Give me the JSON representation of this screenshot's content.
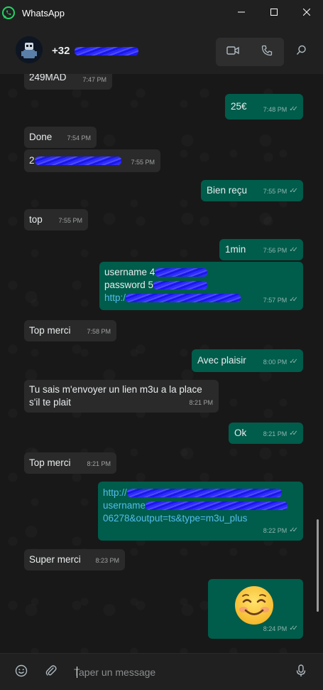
{
  "window": {
    "title": "WhatsApp"
  },
  "header": {
    "contact_prefix": "+32"
  },
  "colors": {
    "incoming": "#2a2a2a",
    "outgoing": "#005c4b",
    "link": "#53bdeb",
    "accent": "#00a884"
  },
  "messages": [
    {
      "text": "249MAD",
      "time": "7:47 PM"
    },
    {
      "text": "25€",
      "time": "7:48 PM"
    },
    {
      "text": "Done",
      "time": "7:54 PM"
    },
    {
      "text": "2",
      "time": "7:55 PM"
    },
    {
      "text": "Bien reçu",
      "time": "7:55 PM"
    },
    {
      "text": "top",
      "time": "7:55 PM"
    },
    {
      "text": "1min",
      "time": "7:56 PM"
    },
    {
      "line1": "username 4",
      "line2": "password 5",
      "line3": "http:/",
      "time": "7:57 PM"
    },
    {
      "text": "Top merci",
      "time": "7:58 PM"
    },
    {
      "text": "Avec plaisir",
      "time": "8:00 PM"
    },
    {
      "line1": "Tu sais m'envoyer un lien m3u a la place",
      "line2": "s'il te plait",
      "time": "8:21 PM"
    },
    {
      "text": "Ok",
      "time": "8:21 PM"
    },
    {
      "text": "Top merci",
      "time": "8:21 PM"
    },
    {
      "line1": "http://",
      "line2": "username",
      "line3": "06278&output=ts&type=m3u_plus",
      "time": "8:22 PM"
    },
    {
      "text": "Super merci",
      "time": "8:23 PM"
    },
    {
      "emoji": "☺️",
      "time": "8:24 PM"
    }
  ],
  "input": {
    "placeholder": "Taper un message"
  },
  "icons": {
    "app": "whatsapp-icon",
    "minimize": "minimize-icon",
    "maximize": "maximize-icon",
    "close": "close-icon",
    "video": "video-call-icon",
    "voice": "voice-call-icon",
    "search": "search-icon",
    "emoji": "emoji-icon",
    "attach": "paperclip-icon",
    "mic": "microphone-icon"
  }
}
